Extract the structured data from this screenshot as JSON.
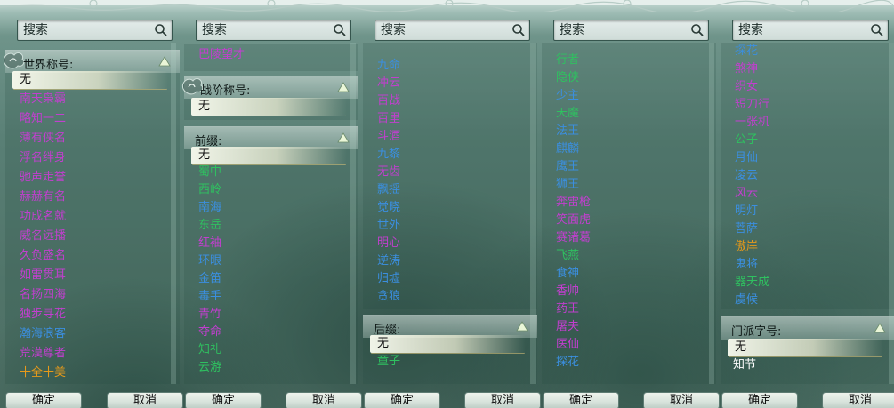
{
  "search_placeholder": "搜索",
  "buttons": {
    "confirm": "确定",
    "cancel": "取消"
  },
  "colors": {
    "pink": "#c23fcf",
    "green": "#2fc160",
    "blue": "#3b8fe0",
    "orange": "#e79a1a"
  },
  "col1": {
    "header": "世界称号:",
    "selected": "无",
    "items": [
      {
        "text": "南天枭霸",
        "c": "pink"
      },
      {
        "text": "略知一二",
        "c": "pink"
      },
      {
        "text": "薄有侠名",
        "c": "pink"
      },
      {
        "text": "浮名绊身",
        "c": "pink"
      },
      {
        "text": "驰声走誉",
        "c": "pink"
      },
      {
        "text": "赫赫有名",
        "c": "pink"
      },
      {
        "text": "功成名就",
        "c": "pink"
      },
      {
        "text": "威名远播",
        "c": "pink"
      },
      {
        "text": "久负盛名",
        "c": "pink"
      },
      {
        "text": "如雷贯耳",
        "c": "pink"
      },
      {
        "text": "名扬四海",
        "c": "pink"
      },
      {
        "text": "独步寻花",
        "c": "pink"
      },
      {
        "text": "瀚海浪客",
        "c": "blue"
      },
      {
        "text": "荒漠尊者",
        "c": "pink"
      },
      {
        "text": "十全十美",
        "c": "orange"
      }
    ]
  },
  "col2": {
    "top_item": "巴陵望才",
    "header1": "战阶称号:",
    "selected1": "无",
    "header2": "前缀:",
    "selected2": "无",
    "items": [
      {
        "text": "蜀中",
        "c": "green"
      },
      {
        "text": "西岭",
        "c": "green"
      },
      {
        "text": "南海",
        "c": "blue"
      },
      {
        "text": "东岳",
        "c": "green"
      },
      {
        "text": "红袖",
        "c": "pink"
      },
      {
        "text": "环眼",
        "c": "blue"
      },
      {
        "text": "金笛",
        "c": "blue"
      },
      {
        "text": "毒手",
        "c": "blue"
      },
      {
        "text": "青竹",
        "c": "pink"
      },
      {
        "text": "夺命",
        "c": "pink"
      },
      {
        "text": "知礼",
        "c": "green"
      },
      {
        "text": "云游",
        "c": "green"
      }
    ]
  },
  "col3": {
    "items": [
      {
        "text": "九命",
        "c": "blue"
      },
      {
        "text": "冲云",
        "c": "pink"
      },
      {
        "text": "百战",
        "c": "pink"
      },
      {
        "text": "百里",
        "c": "pink"
      },
      {
        "text": "斗酒",
        "c": "pink"
      },
      {
        "text": "九黎",
        "c": "blue"
      },
      {
        "text": "无齿",
        "c": "pink"
      },
      {
        "text": "飘摇",
        "c": "blue"
      },
      {
        "text": "觉晓",
        "c": "blue"
      },
      {
        "text": "世外",
        "c": "blue"
      },
      {
        "text": "明心",
        "c": "pink"
      },
      {
        "text": "逆涛",
        "c": "blue"
      },
      {
        "text": "归墟",
        "c": "blue"
      },
      {
        "text": "贪狼",
        "c": "blue"
      }
    ],
    "header": "后缀:",
    "selected": "无",
    "items2": [
      {
        "text": "童子",
        "c": "green"
      }
    ]
  },
  "col4": {
    "items": [
      {
        "text": "行者",
        "c": "green"
      },
      {
        "text": "隐侠",
        "c": "green"
      },
      {
        "text": "少主",
        "c": "blue"
      },
      {
        "text": "天魔",
        "c": "green"
      },
      {
        "text": "法王",
        "c": "blue"
      },
      {
        "text": "麒麟",
        "c": "blue"
      },
      {
        "text": "鹰王",
        "c": "blue"
      },
      {
        "text": "狮王",
        "c": "blue"
      },
      {
        "text": "奔雷枪",
        "c": "pink"
      },
      {
        "text": "笑面虎",
        "c": "pink"
      },
      {
        "text": "赛诸葛",
        "c": "pink"
      },
      {
        "text": "飞燕",
        "c": "green"
      },
      {
        "text": "食神",
        "c": "blue"
      },
      {
        "text": "香帅",
        "c": "pink"
      },
      {
        "text": "药王",
        "c": "pink"
      },
      {
        "text": "屠夫",
        "c": "pink"
      },
      {
        "text": "医仙",
        "c": "pink"
      },
      {
        "text": "探花",
        "c": "blue"
      }
    ]
  },
  "col5": {
    "items": [
      {
        "text": "探花",
        "c": "blue"
      },
      {
        "text": "煞神",
        "c": "pink"
      },
      {
        "text": "织女",
        "c": "pink"
      },
      {
        "text": "短刀行",
        "c": "pink"
      },
      {
        "text": "一张机",
        "c": "pink"
      },
      {
        "text": "公子",
        "c": "green"
      },
      {
        "text": "月仙",
        "c": "blue"
      },
      {
        "text": "凌云",
        "c": "blue"
      },
      {
        "text": "风云",
        "c": "pink"
      },
      {
        "text": "明灯",
        "c": "blue"
      },
      {
        "text": "菩萨",
        "c": "blue"
      },
      {
        "text": "傲岸",
        "c": "orange"
      },
      {
        "text": "鬼将",
        "c": "blue"
      },
      {
        "text": "器天成",
        "c": "green"
      },
      {
        "text": "虞候",
        "c": "blue"
      }
    ],
    "header": "门派字号:",
    "selected": "无",
    "items2": [
      {
        "text": "知节",
        "c": "white"
      }
    ]
  }
}
